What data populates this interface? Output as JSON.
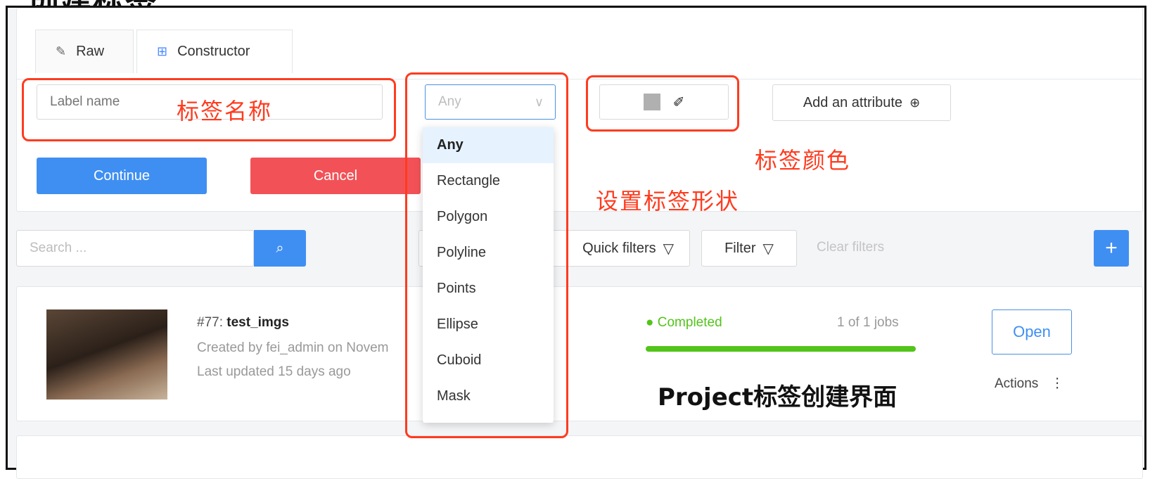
{
  "heading": "创建标签",
  "tabs": [
    {
      "label": "Raw",
      "icon": "pencil-icon"
    },
    {
      "label": "Constructor",
      "icon": "blocks-icon"
    }
  ],
  "form": {
    "label_placeholder": "Label name",
    "shape_value": "Any",
    "add_attribute": "Add an attribute",
    "continue": "Continue",
    "cancel": "Cancel"
  },
  "shape_options": [
    "Any",
    "Rectangle",
    "Polygon",
    "Polyline",
    "Points",
    "Ellipse",
    "Cuboid",
    "Mask"
  ],
  "annotations": {
    "label_name": "标签名称",
    "label_color": "标签颜色",
    "label_shape": "设置标签形状",
    "caption": "Project标签创建界面"
  },
  "toolbar": {
    "search_placeholder": "Search ...",
    "quick_filters": "Quick filters",
    "filter": "Filter",
    "clear_filters": "Clear filters",
    "add": "+"
  },
  "task": {
    "id": "#77:",
    "name": "test_imgs",
    "created": "Created by fei_admin on Novem",
    "updated": "Last updated 15 days ago",
    "status": "Completed",
    "jobs": "1 of 1 jobs",
    "progress": 1.0,
    "open": "Open",
    "actions": "Actions"
  },
  "colors": {
    "primary": "#3f8ff2",
    "danger": "#f25257",
    "annotation": "#ff3b1f",
    "completed": "#52c41a"
  }
}
